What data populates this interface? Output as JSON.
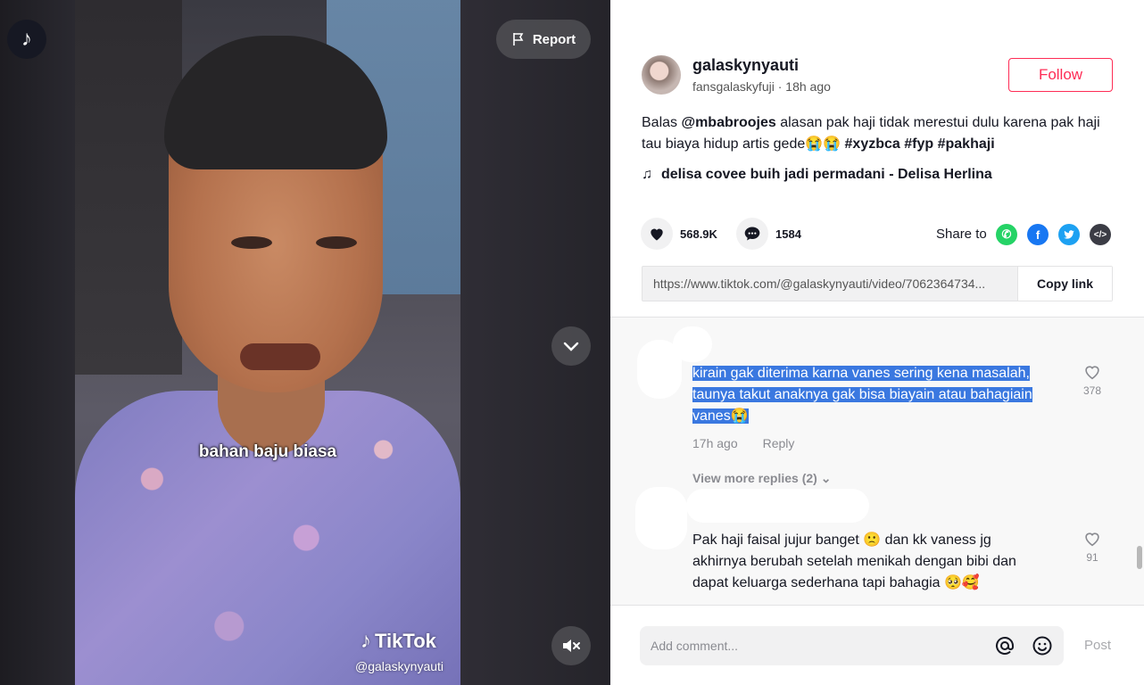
{
  "video": {
    "subtitle": "bahan baju biasa",
    "watermark_brand": "TikTok",
    "watermark_handle": "@galaskynyauti",
    "report_label": "Report"
  },
  "author": {
    "username": "galaskynyauti",
    "nickname": "fansgalaskyfuji",
    "time_ago": "18h ago",
    "follow_label": "Follow"
  },
  "caption": {
    "prefix": "Balas ",
    "mention": "@mbabroojes",
    "text": " alasan pak haji tidak merestui dulu karena pak haji tau biaya hidup artis gede😭😭 ",
    "tags": [
      "#xyzbca",
      "#fyp",
      "#pakhaji"
    ]
  },
  "music": {
    "title": "delisa covee buih jadi permadani - Delisa Herlina"
  },
  "stats": {
    "likes": "568.9K",
    "comments": "1584"
  },
  "share": {
    "label": "Share to",
    "link": "https://www.tiktok.com/@galaskynyauti/video/7062364734...",
    "copy_label": "Copy link"
  },
  "comments": [
    {
      "lines": [
        "kirain gak diterima karna vanes sering kena masalah,",
        "taunya takut anaknya gak bisa biayain atau bahagiain",
        "vanes😭"
      ],
      "time": "17h ago",
      "reply_label": "Reply",
      "likes": "378",
      "view_more": "View more replies (2)"
    },
    {
      "lines": [
        "Pak haji faisal jujur banget 🙁 dan kk vaness jg",
        "akhirnya berubah setelah menikah dengan bibi dan",
        "dapat keluarga sederhana tapi bahagia 🥺🥰"
      ],
      "likes": "91"
    }
  ],
  "comment_input": {
    "placeholder": "Add comment...",
    "post_label": "Post"
  },
  "colors": {
    "accent": "#fe2c55",
    "highlight": "#3a78e0"
  }
}
